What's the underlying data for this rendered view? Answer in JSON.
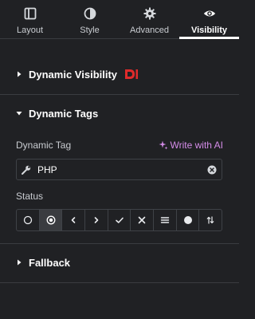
{
  "tabs": [
    {
      "label": "Layout",
      "icon": "layout-icon"
    },
    {
      "label": "Style",
      "icon": "half-circle-icon"
    },
    {
      "label": "Advanced",
      "icon": "gear-icon"
    },
    {
      "label": "Visibility",
      "icon": "eye-icon",
      "active": true
    }
  ],
  "sections": {
    "dynamic_visibility": {
      "title": "Dynamic Visibility",
      "expanded": false,
      "badge_icon": "dynamic-d-logo-icon"
    },
    "dynamic_tags": {
      "title": "Dynamic Tags",
      "expanded": true
    },
    "fallback": {
      "title": "Fallback",
      "expanded": false
    }
  },
  "dynamic_tag": {
    "label": "Dynamic Tag",
    "ai_link": "Write with AI",
    "value": "PHP"
  },
  "status": {
    "label": "Status",
    "selected_index": 1,
    "options": [
      "empty-circle-icon",
      "target-circle-icon",
      "chevron-left-icon",
      "chevron-right-icon",
      "check-icon",
      "x-icon",
      "menu-lines-icon",
      "filled-circle-icon",
      "sort-arrows-icon"
    ]
  },
  "colors": {
    "background": "#202124",
    "accent_ai": "#d48ce8",
    "badge_red": "#e02b2b",
    "text": "#ffffff"
  }
}
